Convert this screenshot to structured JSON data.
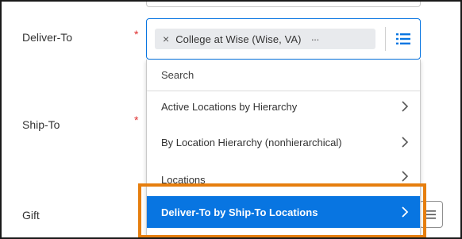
{
  "form": {
    "deliver_to_label": "Deliver-To",
    "ship_to_label": "Ship-To",
    "gift_label": "Gift",
    "required_mark": "*"
  },
  "deliver_to": {
    "selected_value": "College at Wise (Wise, VA)",
    "remove_symbol": "×",
    "more_symbol": "···",
    "list_icon": "list-icon"
  },
  "dropdown": {
    "search_placeholder": "Search",
    "options": [
      {
        "label": "Active Locations by Hierarchy",
        "selected": false
      },
      {
        "label": "By Location Hierarchy (nonhierarchical)",
        "selected": false
      },
      {
        "label": "Locations",
        "selected": false
      },
      {
        "label": "Deliver-To by Ship-To Locations",
        "selected": true
      }
    ]
  },
  "colors": {
    "accent": "#0875e1",
    "required": "#de2f2f",
    "highlight": "#e67e0e",
    "pill_bg": "#e8eaed"
  }
}
